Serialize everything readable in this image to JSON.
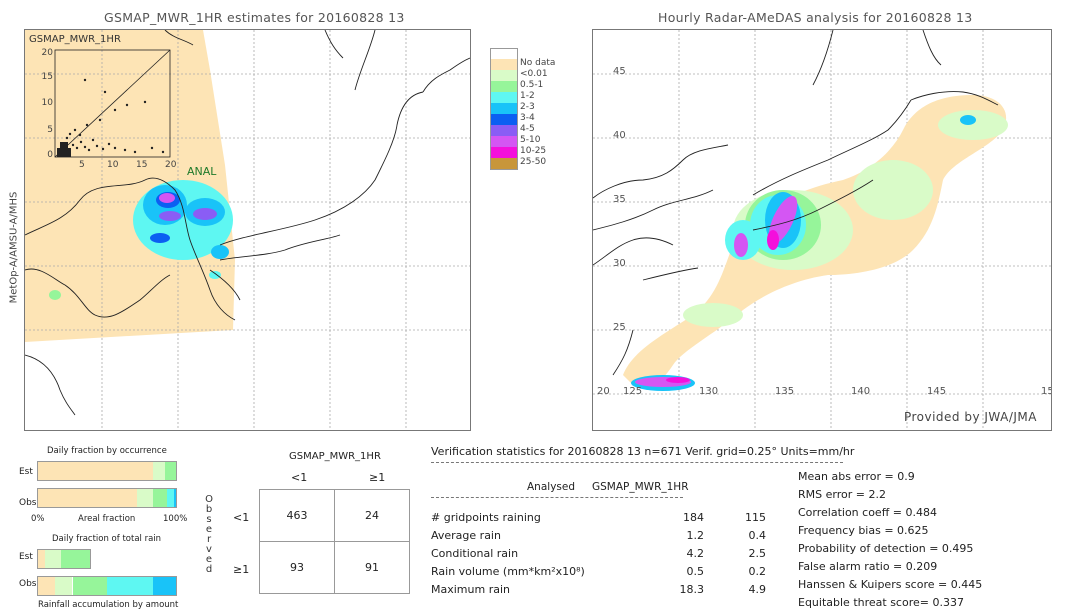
{
  "left_panel": {
    "title": "GSMAP_MWR_1HR estimates for 20160828 13",
    "side_label": "MetOp-A/AMSU-A/MHS",
    "inset_label": "GSMAP_MWR_1HR",
    "inset_corner_label": "ANAL",
    "inset_y_ticks": [
      "20",
      "15",
      "10",
      "5",
      "0"
    ],
    "inset_x_ticks": [
      "5",
      "10",
      "15",
      "20"
    ]
  },
  "right_panel": {
    "title": "Hourly Radar-AMeDAS analysis for 20160828 13",
    "lat_ticks": [
      "45",
      "40",
      "35",
      "30",
      "25",
      "20"
    ],
    "lon_ticks": [
      "125",
      "130",
      "135",
      "140",
      "145",
      "15"
    ],
    "credit": "Provided by JWA/JMA"
  },
  "legend": {
    "items": [
      {
        "label": "",
        "color": "#ffffff"
      },
      {
        "label": "No data",
        "color": "#fde4b5"
      },
      {
        "label": "<0.01",
        "color": "#d9fbc8"
      },
      {
        "label": "0.5-1",
        "color": "#96f59a"
      },
      {
        "label": "1-2",
        "color": "#5ef7f2"
      },
      {
        "label": "2-3",
        "color": "#19c3f8"
      },
      {
        "label": "3-4",
        "color": "#0b5ff2"
      },
      {
        "label": "4-5",
        "color": "#8a5df5"
      },
      {
        "label": "5-10",
        "color": "#d456f3"
      },
      {
        "label": "10-25",
        "color": "#f40fdc"
      },
      {
        "label": "25-50",
        "color": "#c8963a"
      }
    ]
  },
  "occurrence": {
    "title": "Daily fraction by occurrence",
    "est_label": "Est",
    "obs_label": "Obs",
    "axis_left": "0%",
    "axis_mid": "Areal fraction",
    "axis_right": "100%",
    "est_fractions": [
      {
        "color": "#fde4b5",
        "value": 0.83
      },
      {
        "color": "#d9fbc8",
        "value": 0.09
      },
      {
        "color": "#96f59a",
        "value": 0.08
      }
    ],
    "obs_fractions": [
      {
        "color": "#fde4b5",
        "value": 0.72
      },
      {
        "color": "#d9fbc8",
        "value": 0.11
      },
      {
        "color": "#96f59a",
        "value": 0.105
      },
      {
        "color": "#5ef7f2",
        "value": 0.05
      },
      {
        "color": "#19c3f8",
        "value": 0.015
      }
    ]
  },
  "total_rain": {
    "title": "Daily fraction of total rain",
    "est_label": "Est",
    "obs_label": "Obs",
    "footer": "Rainfall accumulation by amount",
    "est_fractions": [
      {
        "color": "#fde4b5",
        "value": 0.05
      },
      {
        "color": "#d9fbc8",
        "value": 0.12
      },
      {
        "color": "#96f59a",
        "value": 0.21
      }
    ],
    "obs_fractions": [
      {
        "color": "#fde4b5",
        "value": 0.12
      },
      {
        "color": "#d9fbc8",
        "value": 0.13
      },
      {
        "color": "#96f59a",
        "value": 0.25
      },
      {
        "color": "#5ef7f2",
        "value": 0.33
      },
      {
        "color": "#19c3f8",
        "value": 0.17
      }
    ]
  },
  "contingency": {
    "title": "GSMAP_MWR_1HR",
    "col_headers": [
      "<1",
      "≥1"
    ],
    "row_headers": [
      "<1",
      "≥1"
    ],
    "side_label": [
      "O",
      "b",
      "s",
      "e",
      "r",
      "v",
      "e",
      "d"
    ],
    "cells": [
      [
        "463",
        "24"
      ],
      [
        "93",
        "91"
      ]
    ]
  },
  "verification": {
    "header": "Verification statistics for 20160828 13   n=671   Verif. grid=0.25°   Units=mm/hr",
    "col_analysed": "Analysed",
    "col_gsmap": "GSMAP_MWR_1HR",
    "rows": [
      {
        "label": "# gridpoints raining",
        "analysed": "184",
        "gsmap": "115"
      },
      {
        "label": "Average rain",
        "analysed": "1.2",
        "gsmap": "0.4"
      },
      {
        "label": "Conditional rain",
        "analysed": "4.2",
        "gsmap": "2.5"
      },
      {
        "label": "Rain volume (mm*km²x10⁸)",
        "analysed": "0.5",
        "gsmap": "0.2"
      },
      {
        "label": "Maximum rain",
        "analysed": "18.3",
        "gsmap": "4.9"
      }
    ],
    "scores": [
      "Mean abs error = 0.9",
      "RMS error = 2.2",
      "Correlation coeff = 0.484",
      "Frequency bias = 0.625",
      "Probability of detection = 0.495",
      "False alarm ratio = 0.209",
      "Hanssen & Kuipers score = 0.445",
      "Equitable threat score= 0.337"
    ]
  }
}
